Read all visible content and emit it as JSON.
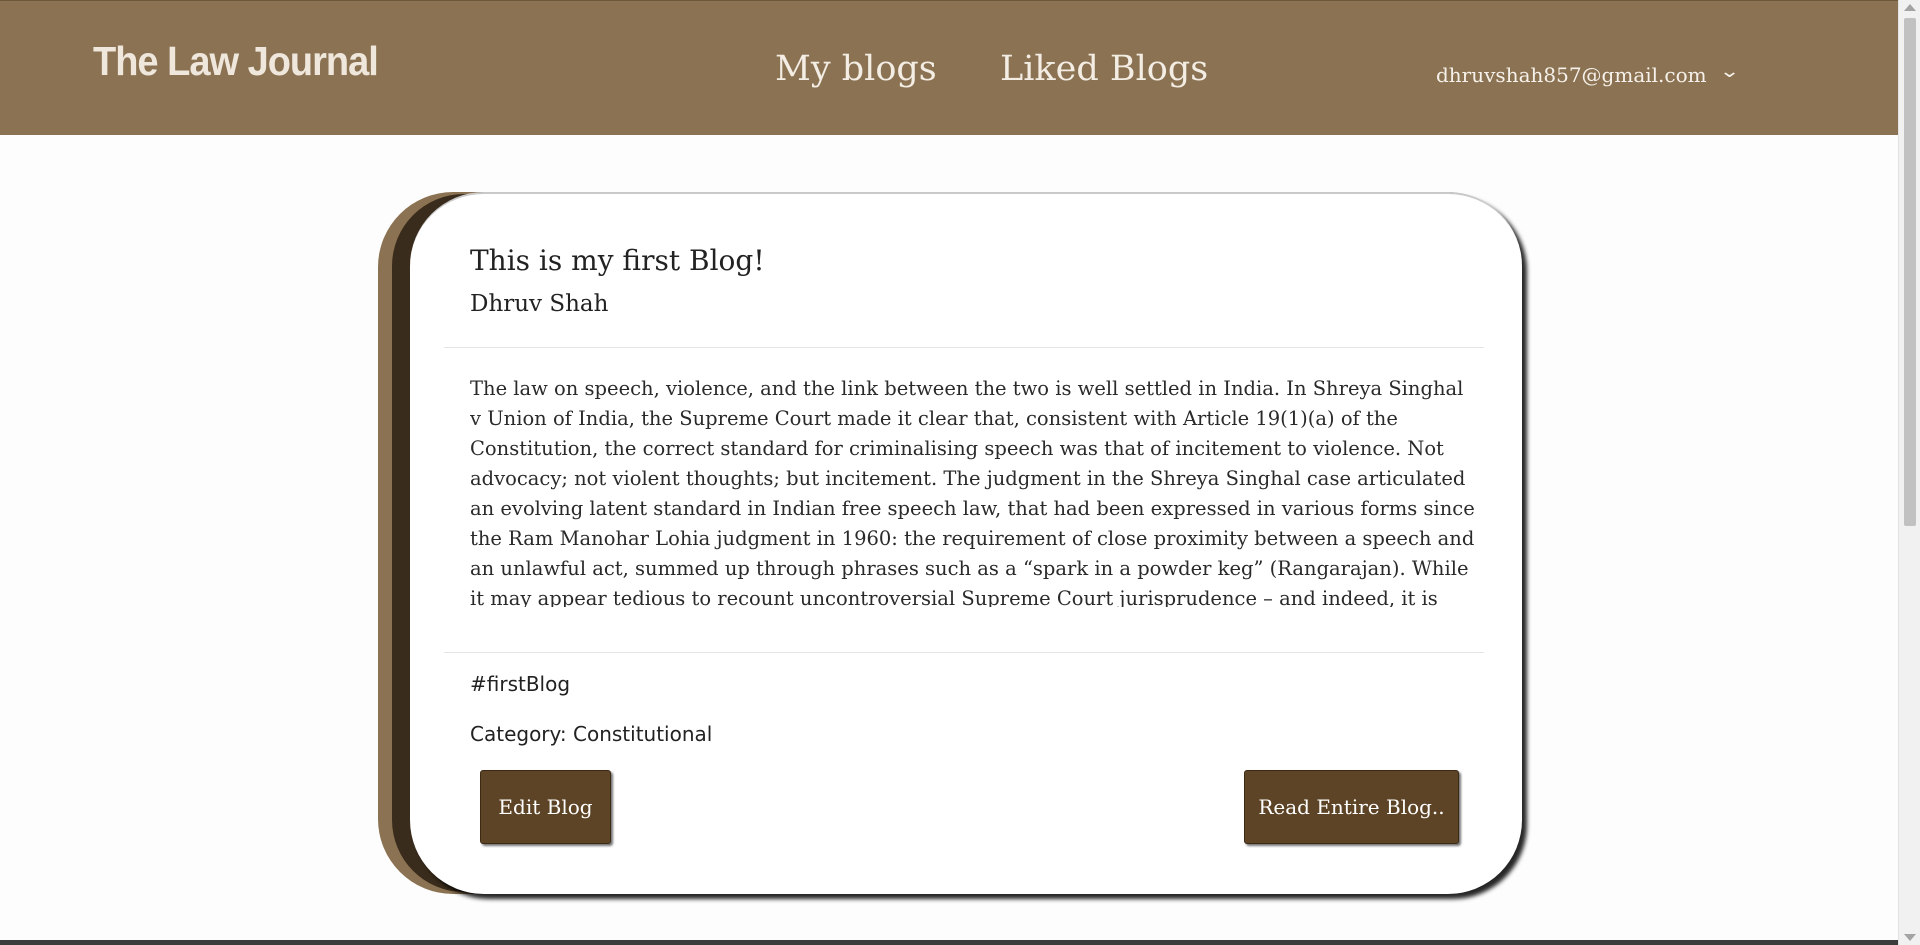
{
  "navbar": {
    "brand": "The Law Journal",
    "links": [
      "My blogs",
      "Liked Blogs"
    ],
    "user_email": "dhruvshah857@gmail.com",
    "user_menu_icon": "chevron-down-icon"
  },
  "blog": {
    "title": "This is my first Blog!",
    "author": "Dhruv Shah",
    "excerpt": "The law on speech, violence, and the link between the two is well settled in India. In Shreya Singhal v Union of India, the Supreme Court made it clear that, consistent with Article 19(1)(a) of the Constitution, the correct standard for criminalising speech was that of incitement to violence. Not advocacy; not violent thoughts; but incitement. The judgment in the Shreya Singhal case articulated an evolving latent standard in Indian free speech law, that had been expressed in various forms since the Ram Manohar Lohia judgment in 1960: the requirement of close proximity between a speech and an unlawful act, summed up through phrases such as a “spark in a powder keg” (Rangarajan). While it may appear tedious to recount uncontroversial Supreme Court jurisprudence – and indeed, it is",
    "tag": "#firstBlog",
    "category": "Category: Constitutional",
    "edit_label": "Edit Blog",
    "read_label": "Read Entire Blog.."
  },
  "colors": {
    "brand_brown": "#8b7252",
    "button_brown": "#5e4426",
    "dark_brown": "#3a2c1c"
  }
}
